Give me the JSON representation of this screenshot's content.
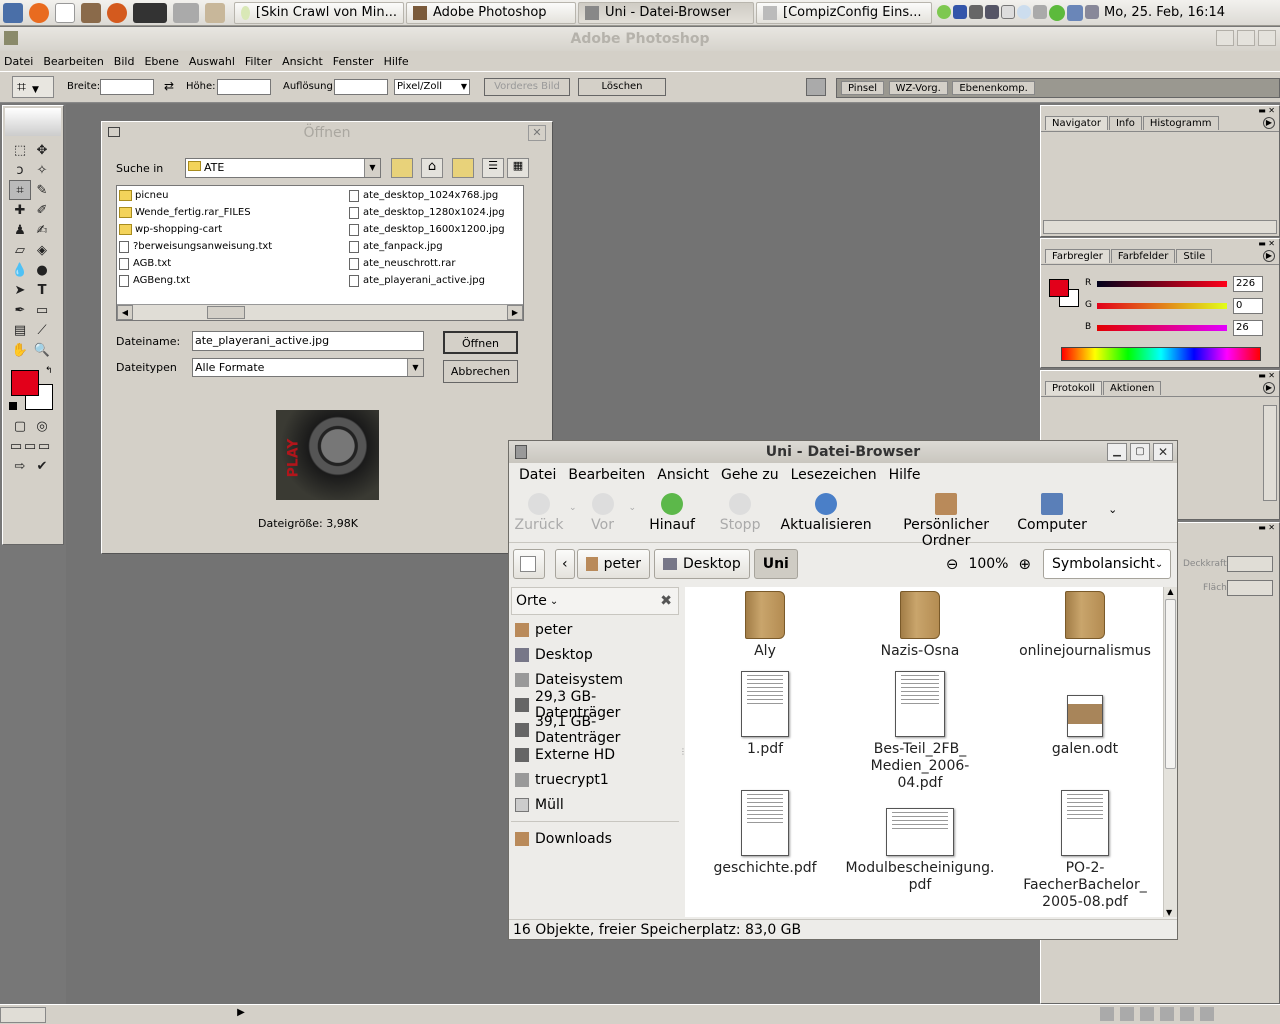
{
  "taskbar": {
    "tasks": [
      "[Skin Crawl von Min...",
      "Adobe Photoshop",
      "Uni - Datei-Browser",
      "[CompizConfig Eins..."
    ],
    "clock": "Mo, 25. Feb, 16:14"
  },
  "photoshop": {
    "title": "Adobe Photoshop",
    "menu": [
      "Datei",
      "Bearbeiten",
      "Bild",
      "Ebene",
      "Auswahl",
      "Filter",
      "Ansicht",
      "Fenster",
      "Hilfe"
    ],
    "options": {
      "breite_label": "Breite:",
      "hoehe_label": "Höhe:",
      "aufloesung_label": "Auflösung:",
      "unit_value": "Pixel/Zoll",
      "front_image_btn": "Vorderes Bild",
      "clear_btn": "Löschen",
      "tabs": [
        "Pinsel",
        "WZ-Vorg.",
        "Ebenenkomp."
      ]
    },
    "colors": {
      "foreground": "#e2001a",
      "background": "#ffffff"
    }
  },
  "open_dialog": {
    "title": "Öffnen",
    "look_in_label": "Suche in",
    "look_in_value": "ATE",
    "files_left": [
      {
        "name": "picneu",
        "type": "folder"
      },
      {
        "name": "Wende_fertig.rar_FILES",
        "type": "folder"
      },
      {
        "name": "wp-shopping-cart",
        "type": "folder"
      },
      {
        "name": "?berweisungsanweisung.txt",
        "type": "file"
      },
      {
        "name": "AGB.txt",
        "type": "file"
      },
      {
        "name": "AGBeng.txt",
        "type": "file"
      }
    ],
    "files_right": [
      {
        "name": "ate_desktop_1024x768.jpg",
        "type": "file"
      },
      {
        "name": "ate_desktop_1280x1024.jpg",
        "type": "file"
      },
      {
        "name": "ate_desktop_1600x1200.jpg",
        "type": "file"
      },
      {
        "name": "ate_fanpack.jpg",
        "type": "file"
      },
      {
        "name": "ate_neuschrott.rar",
        "type": "file"
      },
      {
        "name": "ate_playerani_active.jpg",
        "type": "file"
      }
    ],
    "filename_label": "Dateiname:",
    "filename_value": "ate_playerani_active.jpg",
    "filetype_label": "Dateitypen",
    "filetype_value": "Alle Formate",
    "open_btn": "Öffnen",
    "cancel_btn": "Abbrechen",
    "preview_text": "PLAY",
    "filesize": "Dateigröße: 3,98K"
  },
  "panels": {
    "navigator_tabs": [
      "Navigator",
      "Info",
      "Histogramm"
    ],
    "color_tabs": [
      "Farbregler",
      "Farbfelder",
      "Stile"
    ],
    "rgb": [
      {
        "label": "R",
        "value": "226"
      },
      {
        "label": "G",
        "value": "0"
      },
      {
        "label": "B",
        "value": "26"
      }
    ],
    "history_tabs": [
      "Protokoll",
      "Aktionen"
    ],
    "layer_labels": [
      "Deckkraft:",
      "Fläche:"
    ]
  },
  "file_browser": {
    "title": "Uni - Datei-Browser",
    "menu": [
      "Datei",
      "Bearbeiten",
      "Ansicht",
      "Gehe zu",
      "Lesezeichen",
      "Hilfe"
    ],
    "toolbar": [
      "Zurück",
      "Vor",
      "Hinauf",
      "Stopp",
      "Aktualisieren",
      "Persönlicher Ordner",
      "Computer"
    ],
    "crumbs": [
      "peter",
      "Desktop",
      "Uni"
    ],
    "zoom": "100%",
    "view_mode": "Symbolansicht",
    "places_label": "Orte",
    "places": [
      "peter",
      "Desktop",
      "Dateisystem",
      "29,3 GB-Datenträger",
      "39,1 GB-Datenträger",
      "Externe HD",
      "truecrypt1",
      "Müll"
    ],
    "bookmarks": [
      "Downloads"
    ],
    "items": [
      {
        "name": "Aly",
        "kind": "folder"
      },
      {
        "name": "Nazis-Osna",
        "kind": "folder"
      },
      {
        "name": "onlinejournalismus",
        "kind": "folder"
      },
      {
        "name": "1.pdf",
        "kind": "doc"
      },
      {
        "name": "Bes-Teil_2FB_ Medien_2006-04.pdf",
        "kind": "doc"
      },
      {
        "name": "galen.odt",
        "kind": "odt"
      },
      {
        "name": "geschichte.pdf",
        "kind": "doc"
      },
      {
        "name": "Modulbescheinigung. pdf",
        "kind": "landscape"
      },
      {
        "name": "PO-2- FaecherBachelor_ 2005-08.pdf",
        "kind": "doc"
      }
    ],
    "status": "16 Objekte, freier Speicherplatz: 83,0 GB"
  }
}
